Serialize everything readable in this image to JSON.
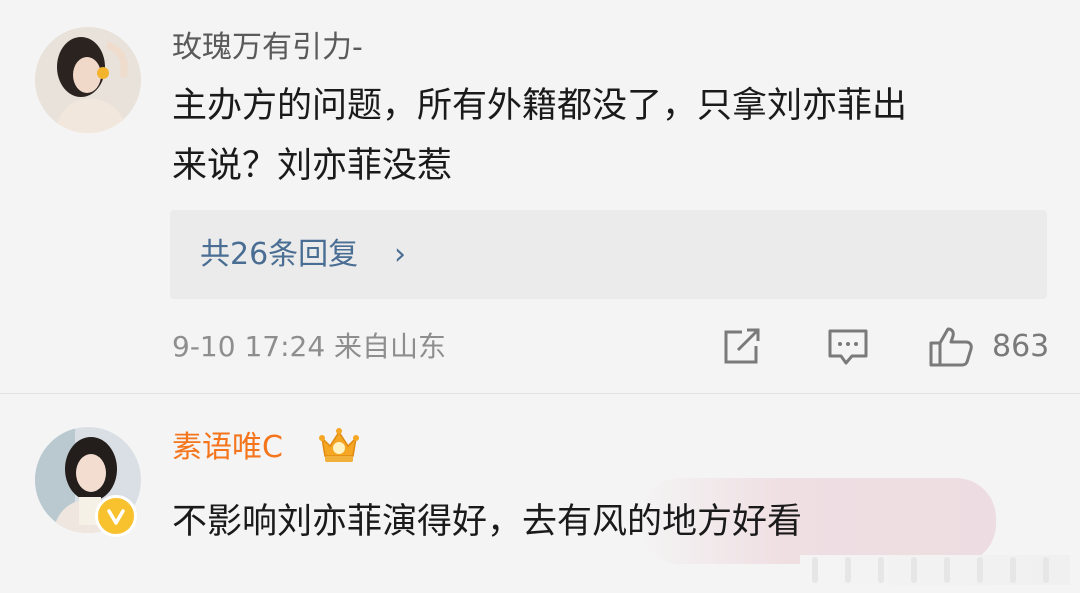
{
  "comments": [
    {
      "username": "玫瑰万有引力-",
      "content_line1": "主办方的问题，所有外籍都没了，只拿刘亦菲出",
      "content_line2": "来说？刘亦菲没惹",
      "replies_label": "共26条回复",
      "replies_chevron": "›",
      "meta": "9-10 17:24 来自山东",
      "likes": "863"
    },
    {
      "username": "素语唯C",
      "content": "不影响刘亦菲演得好，去有风的地方好看"
    }
  ],
  "colors": {
    "username_gray": "#5a5a5a",
    "username_orange": "#f4751c",
    "link_blue": "#4a6d93",
    "meta_gray": "#8e8e8e"
  },
  "icons": [
    "share-icon",
    "comment-icon",
    "thumbs-up-icon",
    "crown-badge-icon",
    "verified-icon"
  ]
}
